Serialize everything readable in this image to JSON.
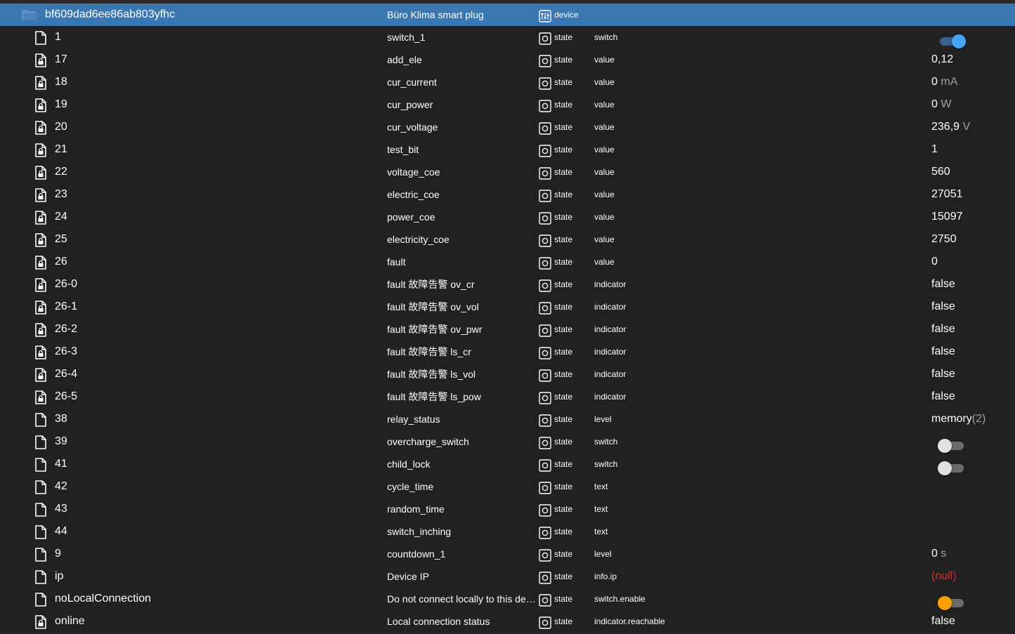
{
  "device": {
    "id": "bf609dad6ee86ab803yfhc",
    "name": "Büro Klima smart plug",
    "type": "device",
    "icon": "folder-open-icon",
    "type_icon": "device-icon"
  },
  "rows": [
    {
      "id": "1",
      "name": "switch_1",
      "type": "state",
      "role": "switch",
      "icon": "file-icon",
      "value_kind": "toggle",
      "toggle": "on"
    },
    {
      "id": "17",
      "name": "add_ele",
      "type": "state",
      "role": "value",
      "icon": "file-lock-icon",
      "value": "0,12",
      "unit": ""
    },
    {
      "id": "18",
      "name": "cur_current",
      "type": "state",
      "role": "value",
      "icon": "file-lock-icon",
      "value": "0",
      "unit": "mA"
    },
    {
      "id": "19",
      "name": "cur_power",
      "type": "state",
      "role": "value",
      "icon": "file-lock-icon",
      "value": "0",
      "unit": "W"
    },
    {
      "id": "20",
      "name": "cur_voltage",
      "type": "state",
      "role": "value",
      "icon": "file-lock-icon",
      "value": "236,9",
      "unit": "V"
    },
    {
      "id": "21",
      "name": "test_bit",
      "type": "state",
      "role": "value",
      "icon": "file-lock-icon",
      "value": "1",
      "unit": ""
    },
    {
      "id": "22",
      "name": "voltage_coe",
      "type": "state",
      "role": "value",
      "icon": "file-lock-icon",
      "value": "560",
      "unit": ""
    },
    {
      "id": "23",
      "name": "electric_coe",
      "type": "state",
      "role": "value",
      "icon": "file-lock-icon",
      "value": "27051",
      "unit": ""
    },
    {
      "id": "24",
      "name": "power_coe",
      "type": "state",
      "role": "value",
      "icon": "file-lock-icon",
      "value": "15097",
      "unit": ""
    },
    {
      "id": "25",
      "name": "electricity_coe",
      "type": "state",
      "role": "value",
      "icon": "file-lock-icon",
      "value": "2750",
      "unit": ""
    },
    {
      "id": "26",
      "name": "fault",
      "type": "state",
      "role": "value",
      "icon": "file-lock-icon",
      "value": "0",
      "unit": ""
    },
    {
      "id": "26-0",
      "name": "fault 故障告警 ov_cr",
      "type": "state",
      "role": "indicator",
      "icon": "file-lock-icon",
      "value": "false",
      "unit": ""
    },
    {
      "id": "26-1",
      "name": "fault 故障告警 ov_vol",
      "type": "state",
      "role": "indicator",
      "icon": "file-lock-icon",
      "value": "false",
      "unit": ""
    },
    {
      "id": "26-2",
      "name": "fault 故障告警 ov_pwr",
      "type": "state",
      "role": "indicator",
      "icon": "file-lock-icon",
      "value": "false",
      "unit": ""
    },
    {
      "id": "26-3",
      "name": "fault 故障告警 ls_cr",
      "type": "state",
      "role": "indicator",
      "icon": "file-lock-icon",
      "value": "false",
      "unit": ""
    },
    {
      "id": "26-4",
      "name": "fault 故障告警 ls_vol",
      "type": "state",
      "role": "indicator",
      "icon": "file-lock-icon",
      "value": "false",
      "unit": ""
    },
    {
      "id": "26-5",
      "name": "fault 故障告警 ls_pow",
      "type": "state",
      "role": "indicator",
      "icon": "file-lock-icon",
      "value": "false",
      "unit": ""
    },
    {
      "id": "38",
      "name": "relay_status",
      "type": "state",
      "role": "level",
      "icon": "file-icon",
      "value": "memory",
      "unit": "(2)"
    },
    {
      "id": "39",
      "name": "overcharge_switch",
      "type": "state",
      "role": "switch",
      "icon": "file-icon",
      "value_kind": "toggle",
      "toggle": "off"
    },
    {
      "id": "41",
      "name": "child_lock",
      "type": "state",
      "role": "switch",
      "icon": "file-icon",
      "value_kind": "toggle",
      "toggle": "off"
    },
    {
      "id": "42",
      "name": "cycle_time",
      "type": "state",
      "role": "text",
      "icon": "file-icon",
      "value": "",
      "unit": ""
    },
    {
      "id": "43",
      "name": "random_time",
      "type": "state",
      "role": "text",
      "icon": "file-icon",
      "value": "",
      "unit": ""
    },
    {
      "id": "44",
      "name": "switch_inching",
      "type": "state",
      "role": "text",
      "icon": "file-icon",
      "value": "",
      "unit": ""
    },
    {
      "id": "9",
      "name": "countdown_1",
      "type": "state",
      "role": "level",
      "icon": "file-icon",
      "value": "0",
      "unit": "s"
    },
    {
      "id": "ip",
      "name": "Device IP",
      "type": "state",
      "role": "info.ip",
      "icon": "file-icon",
      "value": "(null)",
      "unit": "",
      "value_style": "null"
    },
    {
      "id": "noLocalConnection",
      "name": "Do not connect locally to this device",
      "type": "state",
      "role": "switch.enable",
      "icon": "file-icon",
      "value_kind": "toggle",
      "toggle": "warn"
    },
    {
      "id": "online",
      "name": "Local connection status",
      "type": "state",
      "role": "indicator.reachable",
      "icon": "file-lock-icon",
      "value": "false",
      "unit": ""
    }
  ],
  "colors": {
    "background": "#212121",
    "selected_row": "#3a76b0",
    "toggle_on": "#42a5f5",
    "toggle_warn": "#ffa000",
    "null_value": "#d32f2f"
  }
}
